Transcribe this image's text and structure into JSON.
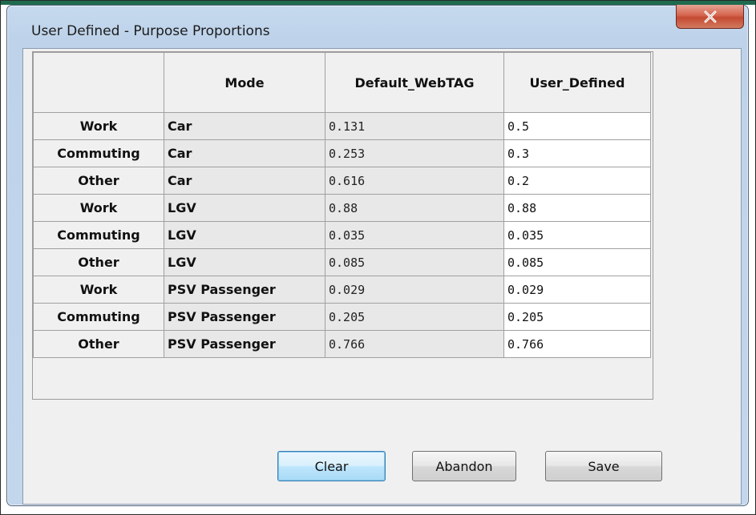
{
  "window": {
    "title": "User Defined - Purpose Proportions",
    "close_glyph": "x"
  },
  "table": {
    "columns": [
      "",
      "Mode",
      "Default_WebTAG",
      "User_Defined"
    ],
    "rows": [
      {
        "purpose": "Work",
        "mode": "Car",
        "default_webtag": "0.131",
        "user_defined": "0.5"
      },
      {
        "purpose": "Commuting",
        "mode": "Car",
        "default_webtag": "0.253",
        "user_defined": "0.3"
      },
      {
        "purpose": "Other",
        "mode": "Car",
        "default_webtag": "0.616",
        "user_defined": "0.2"
      },
      {
        "purpose": "Work",
        "mode": "LGV",
        "default_webtag": "0.88",
        "user_defined": "0.88"
      },
      {
        "purpose": "Commuting",
        "mode": "LGV",
        "default_webtag": "0.035",
        "user_defined": "0.035"
      },
      {
        "purpose": "Other",
        "mode": "LGV",
        "default_webtag": "0.085",
        "user_defined": "0.085"
      },
      {
        "purpose": "Work",
        "mode": "PSV Passenger",
        "default_webtag": "0.029",
        "user_defined": "0.029"
      },
      {
        "purpose": "Commuting",
        "mode": "PSV Passenger",
        "default_webtag": "0.205",
        "user_defined": "0.205"
      },
      {
        "purpose": "Other",
        "mode": "PSV Passenger",
        "default_webtag": "0.766",
        "user_defined": "0.766"
      }
    ]
  },
  "buttons": {
    "clear": "Clear",
    "abandon": "Abandon",
    "save": "Save"
  },
  "colors": {
    "title_bar": "#c2d6ec",
    "close_button": "#c9533b",
    "default_button": "#bee6fd",
    "top_strip": "#1f6b4f"
  },
  "icons": {
    "close": "close-icon"
  }
}
